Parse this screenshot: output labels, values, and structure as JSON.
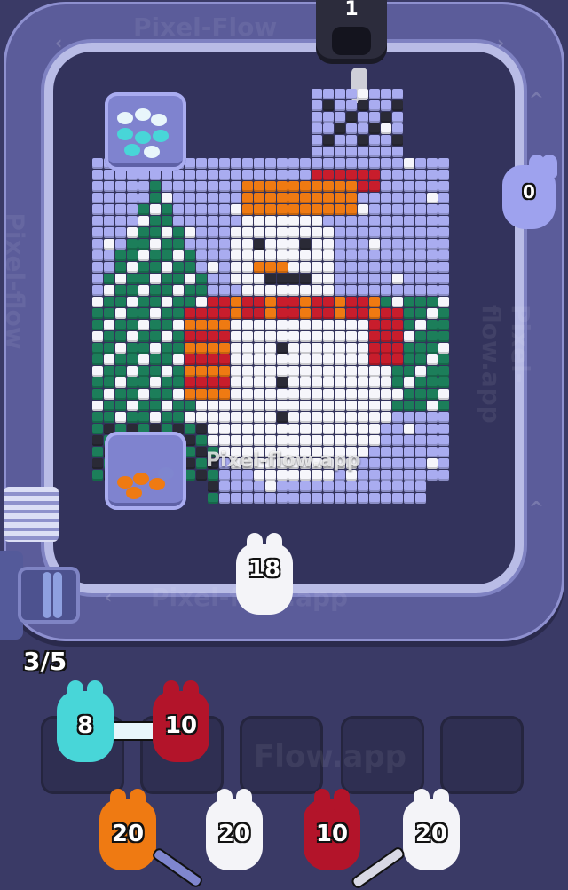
{
  "watermarks": {
    "main": "Pixel-flow.app",
    "top": "Pixel-Flow",
    "bottom": "Pixel-flow.app",
    "slots": "Flow.app",
    "left": "Pixel-flow",
    "right": "Pixel-flow.app"
  },
  "dispenser": {
    "count": "1"
  },
  "track_rabbits": [
    {
      "id": "right",
      "count": "0",
      "color": "#9ea2ee"
    },
    {
      "id": "bottom",
      "count": "18",
      "color": "#f4f4f8"
    }
  ],
  "progress": {
    "label": "3/5",
    "current": 3,
    "total": 5
  },
  "slots": [
    {
      "count": "8",
      "color": "#48d6d8"
    },
    {
      "count": "10",
      "color": "#b3142a"
    },
    {
      "count": "",
      "color": ""
    },
    {
      "count": "",
      "color": ""
    },
    {
      "count": "",
      "color": ""
    }
  ],
  "queue": [
    {
      "count": "20",
      "color": "#ef7a12"
    },
    {
      "count": "20",
      "color": "#f4f4f8"
    },
    {
      "count": "10",
      "color": "#b3142a"
    },
    {
      "count": "20",
      "color": "#f4f4f8"
    }
  ],
  "colors": {
    "sky": "#a9acf0",
    "white": "#f6f6fb",
    "orange": "#ef7a12",
    "red": "#c81d2c",
    "green": "#1c7e5a",
    "dark": "#2a2a36",
    "cyan": "#48d6d8"
  }
}
